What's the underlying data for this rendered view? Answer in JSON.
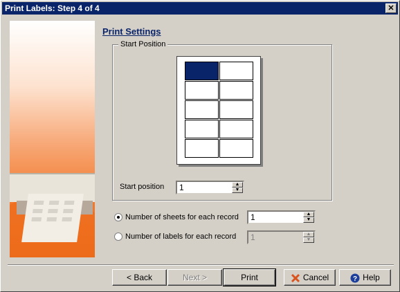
{
  "window": {
    "title": "Print Labels: Step 4 of 4",
    "close_symbol": "✕"
  },
  "main": {
    "heading": "Print Settings",
    "group": {
      "legend": "Start Position",
      "grid": {
        "rows": 5,
        "cols": 2,
        "selected_index": 0
      },
      "start_label": "Start position",
      "start_value": "1"
    },
    "options": [
      {
        "label": "Number of sheets for each record",
        "value": "1",
        "checked": true,
        "enabled": true
      },
      {
        "label": "Number of labels for each record",
        "value": "1",
        "checked": false,
        "enabled": false
      }
    ]
  },
  "buttons": {
    "back": "< Back",
    "next": "Next >",
    "print": "Print",
    "cancel": "Cancel",
    "help": "Help"
  },
  "colors": {
    "accent": "#0a246a",
    "cancel_icon": "#d9531e",
    "help_icon": "#1c3f9c",
    "side_panel": "#ec6e1f"
  },
  "icons": {
    "cancel": "cancel-x-icon",
    "help": "help-question-icon",
    "spin_up": "arrow-up-icon",
    "spin_down": "arrow-down-icon"
  }
}
